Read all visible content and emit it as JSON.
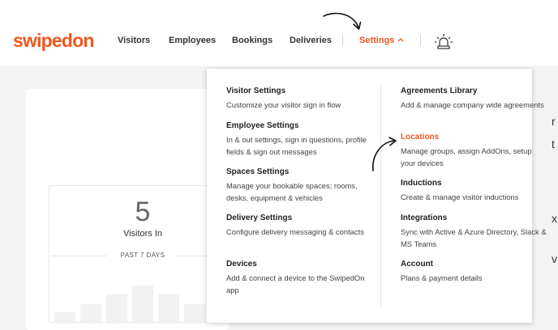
{
  "brand": {
    "logo_text": "swipedon",
    "accent": "#f0561e"
  },
  "nav": {
    "visitors": "Visitors",
    "employees": "Employees",
    "bookings": "Bookings",
    "deliveries": "Deliveries",
    "settings": "Settings",
    "settings_icon": "chevron-up-icon",
    "alert_icon": "alarm-light-icon"
  },
  "dashboard": {
    "visitors_in_count": "5",
    "visitors_in_label": "Visitors In",
    "period": "PAST 7 DAYS",
    "right_edge_glyphs": [
      "r",
      "t",
      "x",
      "v"
    ]
  },
  "settings_menu": {
    "left": [
      {
        "title": "Visitor Settings",
        "desc": "Customize your visitor sign in flow"
      },
      {
        "title": "Employee Settings",
        "desc": "In & out settings, sign in questions, profile fields & sign out messages"
      },
      {
        "title": "Spaces Settings",
        "desc": "Manage your bookable spaces; rooms, desks, equipment & vehicles"
      },
      {
        "title": "Delivery Settings",
        "desc": "Configure delivery messaging & contacts"
      },
      {
        "title": "Devices",
        "desc": "Add & connect a device to the SwipedOn app"
      }
    ],
    "right": [
      {
        "title": "Agreements Library",
        "desc": "Add & manage company wide agreements"
      },
      {
        "title": "Locations",
        "desc": "Manage groups, assign AddOns, setup your devices",
        "highlighted": true
      },
      {
        "title": "Inductions",
        "desc": "Create & manage visitor inductions"
      },
      {
        "title": "Integrations",
        "desc": "Sync with Active & Azure Directory, Slack & MS Teams"
      },
      {
        "title": "Account",
        "desc": "Plans & payment details"
      }
    ]
  }
}
